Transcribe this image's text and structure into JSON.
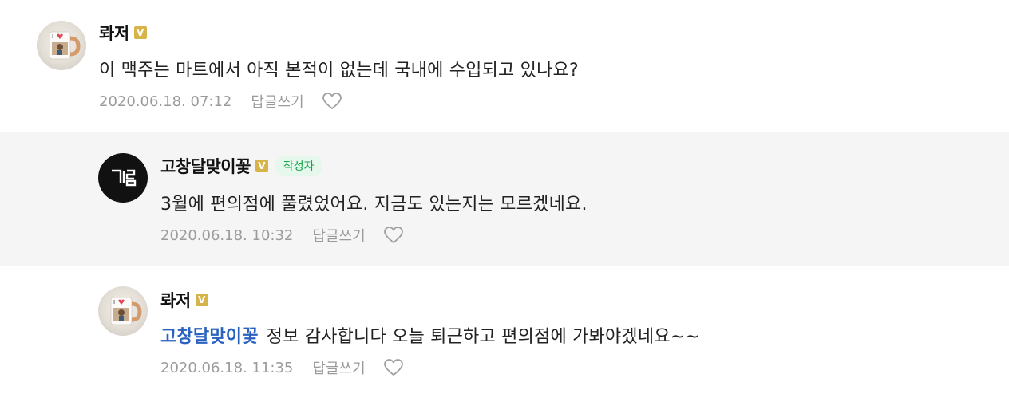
{
  "comments": [
    {
      "author": "롸저",
      "verified_mark": "V",
      "text": "이 맥주는 마트에서 아직 본적이 없는데 국내에 수입되고 있나요?",
      "date": "2020.06.18. 07:12",
      "reply_label": "답글쓰기",
      "avatar_icon": "mug-photo-avatar"
    },
    {
      "author": "고창달맞이꽃",
      "verified_mark": "V",
      "author_tag": "작성자",
      "text": "3월에 편의점에 풀렸었어요. 지금도 있는지는 모르겠네요.",
      "date": "2020.06.18. 10:32",
      "reply_label": "답글쓰기",
      "avatar_icon": "logo-avatar"
    },
    {
      "author": "롸저",
      "verified_mark": "V",
      "mention": "고창달맞이꽃",
      "text": "정보 감사합니다 오늘 퇴근하고 편의점에 가봐야겠네요~~",
      "date": "2020.06.18. 11:35",
      "reply_label": "답글쓰기",
      "avatar_icon": "mug-photo-avatar"
    }
  ],
  "colors": {
    "reply_background": "#f5f5f5",
    "mention": "#2b62c0",
    "author_tag_text": "#14a64b",
    "author_tag_bg": "#e6f7ec",
    "verified": "#d6b44a",
    "meta": "#9b9b9b"
  }
}
